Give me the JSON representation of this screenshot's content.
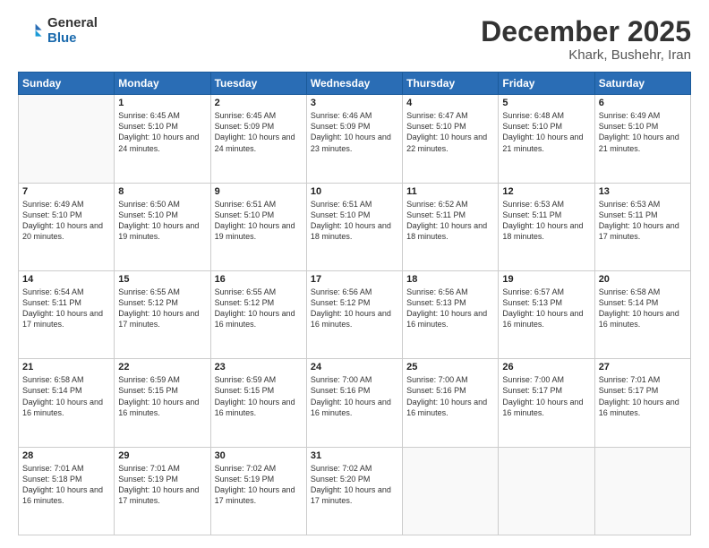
{
  "header": {
    "logo_general": "General",
    "logo_blue": "Blue",
    "month_title": "December 2025",
    "location": "Khark, Bushehr, Iran"
  },
  "days_of_week": [
    "Sunday",
    "Monday",
    "Tuesday",
    "Wednesday",
    "Thursday",
    "Friday",
    "Saturday"
  ],
  "weeks": [
    [
      {
        "day": "",
        "info": ""
      },
      {
        "day": "1",
        "info": "Sunrise: 6:45 AM\nSunset: 5:10 PM\nDaylight: 10 hours\nand 24 minutes."
      },
      {
        "day": "2",
        "info": "Sunrise: 6:45 AM\nSunset: 5:09 PM\nDaylight: 10 hours\nand 24 minutes."
      },
      {
        "day": "3",
        "info": "Sunrise: 6:46 AM\nSunset: 5:09 PM\nDaylight: 10 hours\nand 23 minutes."
      },
      {
        "day": "4",
        "info": "Sunrise: 6:47 AM\nSunset: 5:10 PM\nDaylight: 10 hours\nand 22 minutes."
      },
      {
        "day": "5",
        "info": "Sunrise: 6:48 AM\nSunset: 5:10 PM\nDaylight: 10 hours\nand 21 minutes."
      },
      {
        "day": "6",
        "info": "Sunrise: 6:49 AM\nSunset: 5:10 PM\nDaylight: 10 hours\nand 21 minutes."
      }
    ],
    [
      {
        "day": "7",
        "info": "Sunrise: 6:49 AM\nSunset: 5:10 PM\nDaylight: 10 hours\nand 20 minutes."
      },
      {
        "day": "8",
        "info": "Sunrise: 6:50 AM\nSunset: 5:10 PM\nDaylight: 10 hours\nand 19 minutes."
      },
      {
        "day": "9",
        "info": "Sunrise: 6:51 AM\nSunset: 5:10 PM\nDaylight: 10 hours\nand 19 minutes."
      },
      {
        "day": "10",
        "info": "Sunrise: 6:51 AM\nSunset: 5:10 PM\nDaylight: 10 hours\nand 18 minutes."
      },
      {
        "day": "11",
        "info": "Sunrise: 6:52 AM\nSunset: 5:11 PM\nDaylight: 10 hours\nand 18 minutes."
      },
      {
        "day": "12",
        "info": "Sunrise: 6:53 AM\nSunset: 5:11 PM\nDaylight: 10 hours\nand 18 minutes."
      },
      {
        "day": "13",
        "info": "Sunrise: 6:53 AM\nSunset: 5:11 PM\nDaylight: 10 hours\nand 17 minutes."
      }
    ],
    [
      {
        "day": "14",
        "info": "Sunrise: 6:54 AM\nSunset: 5:11 PM\nDaylight: 10 hours\nand 17 minutes."
      },
      {
        "day": "15",
        "info": "Sunrise: 6:55 AM\nSunset: 5:12 PM\nDaylight: 10 hours\nand 17 minutes."
      },
      {
        "day": "16",
        "info": "Sunrise: 6:55 AM\nSunset: 5:12 PM\nDaylight: 10 hours\nand 16 minutes."
      },
      {
        "day": "17",
        "info": "Sunrise: 6:56 AM\nSunset: 5:12 PM\nDaylight: 10 hours\nand 16 minutes."
      },
      {
        "day": "18",
        "info": "Sunrise: 6:56 AM\nSunset: 5:13 PM\nDaylight: 10 hours\nand 16 minutes."
      },
      {
        "day": "19",
        "info": "Sunrise: 6:57 AM\nSunset: 5:13 PM\nDaylight: 10 hours\nand 16 minutes."
      },
      {
        "day": "20",
        "info": "Sunrise: 6:58 AM\nSunset: 5:14 PM\nDaylight: 10 hours\nand 16 minutes."
      }
    ],
    [
      {
        "day": "21",
        "info": "Sunrise: 6:58 AM\nSunset: 5:14 PM\nDaylight: 10 hours\nand 16 minutes."
      },
      {
        "day": "22",
        "info": "Sunrise: 6:59 AM\nSunset: 5:15 PM\nDaylight: 10 hours\nand 16 minutes."
      },
      {
        "day": "23",
        "info": "Sunrise: 6:59 AM\nSunset: 5:15 PM\nDaylight: 10 hours\nand 16 minutes."
      },
      {
        "day": "24",
        "info": "Sunrise: 7:00 AM\nSunset: 5:16 PM\nDaylight: 10 hours\nand 16 minutes."
      },
      {
        "day": "25",
        "info": "Sunrise: 7:00 AM\nSunset: 5:16 PM\nDaylight: 10 hours\nand 16 minutes."
      },
      {
        "day": "26",
        "info": "Sunrise: 7:00 AM\nSunset: 5:17 PM\nDaylight: 10 hours\nand 16 minutes."
      },
      {
        "day": "27",
        "info": "Sunrise: 7:01 AM\nSunset: 5:17 PM\nDaylight: 10 hours\nand 16 minutes."
      }
    ],
    [
      {
        "day": "28",
        "info": "Sunrise: 7:01 AM\nSunset: 5:18 PM\nDaylight: 10 hours\nand 16 minutes."
      },
      {
        "day": "29",
        "info": "Sunrise: 7:01 AM\nSunset: 5:19 PM\nDaylight: 10 hours\nand 17 minutes."
      },
      {
        "day": "30",
        "info": "Sunrise: 7:02 AM\nSunset: 5:19 PM\nDaylight: 10 hours\nand 17 minutes."
      },
      {
        "day": "31",
        "info": "Sunrise: 7:02 AM\nSunset: 5:20 PM\nDaylight: 10 hours\nand 17 minutes."
      },
      {
        "day": "",
        "info": ""
      },
      {
        "day": "",
        "info": ""
      },
      {
        "day": "",
        "info": ""
      }
    ]
  ]
}
